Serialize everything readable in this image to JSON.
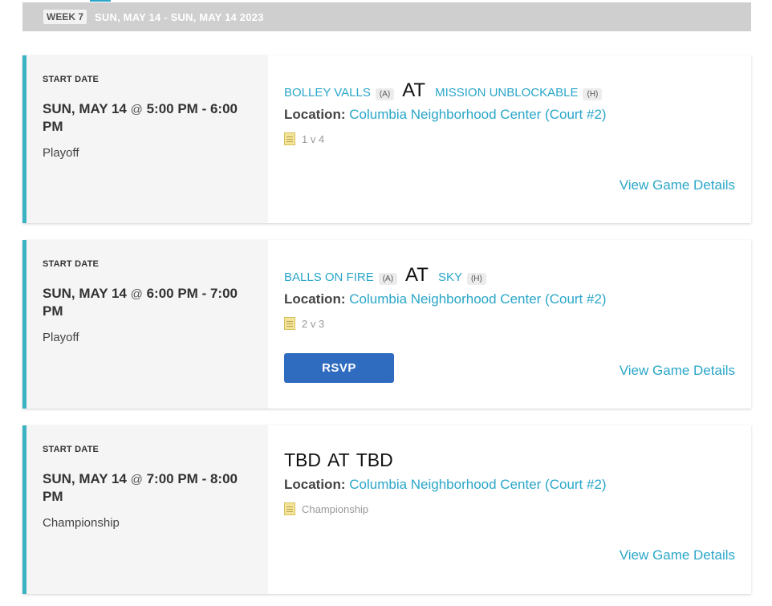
{
  "week": {
    "badge": "WEEK 7",
    "range": "SUN, MAY 14 - SUN, MAY 14 2023"
  },
  "games": [
    {
      "start_label": "START DATE",
      "date": "SUN, MAY 14",
      "at": "@",
      "time": "5:00 PM - 6:00 PM",
      "type": "Playoff",
      "away": "BOLLEY VALLS",
      "away_tag": "(A)",
      "at_word": "AT",
      "home": "MISSION UNBLOCKABLE",
      "home_tag": "(H)",
      "location_label": "Location:",
      "location": "Columbia Neighborhood Center (Court #2)",
      "note": "1 v 4",
      "details": "View Game Details"
    },
    {
      "start_label": "START DATE",
      "date": "SUN, MAY 14",
      "at": "@",
      "time": "6:00 PM - 7:00 PM",
      "type": "Playoff",
      "away": "BALLS ON FIRE",
      "away_tag": "(A)",
      "at_word": "AT",
      "home": "SKY",
      "home_tag": "(H)",
      "location_label": "Location:",
      "location": "Columbia Neighborhood Center (Court #2)",
      "note": "2 v 3",
      "rsvp": "RSVP",
      "details": "View Game Details"
    },
    {
      "start_label": "START DATE",
      "date": "SUN, MAY 14",
      "at": "@",
      "time": "7:00 PM - 8:00 PM",
      "type": "Championship",
      "away": "TBD",
      "at_word": "AT",
      "home": "TBD",
      "location_label": "Location:",
      "location": "Columbia Neighborhood Center (Court #2)",
      "note": "Championship",
      "details": "View Game Details"
    }
  ]
}
